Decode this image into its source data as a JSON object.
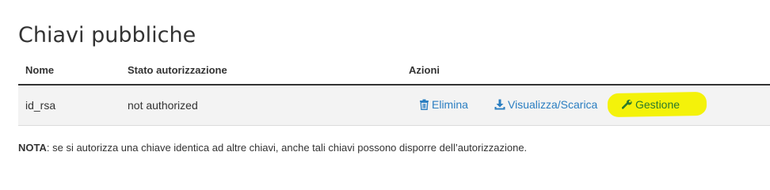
{
  "page": {
    "title": "Chiavi pubbliche"
  },
  "table": {
    "headers": {
      "name": "Nome",
      "status": "Stato autorizzazione",
      "actions": "Azioni"
    },
    "rows": [
      {
        "name": "id_rsa",
        "status": "not authorized",
        "actions": {
          "delete": "Elimina",
          "view": "Visualizza/Scarica",
          "manage": "Gestione"
        }
      }
    ]
  },
  "note": {
    "label": "NOTA",
    "text": ": se si autorizza una chiave identica ad altre chiavi, anche tali chiavi possono disporre dell’autorizzazione."
  },
  "icons": {
    "delete": "trash-icon",
    "view": "download-icon",
    "manage": "wrench-icon"
  },
  "colors": {
    "link": "#2a7ec1",
    "manage_link": "#2b7a2b",
    "highlight": "#f4f20a",
    "row_background": "#f3f3f3"
  }
}
